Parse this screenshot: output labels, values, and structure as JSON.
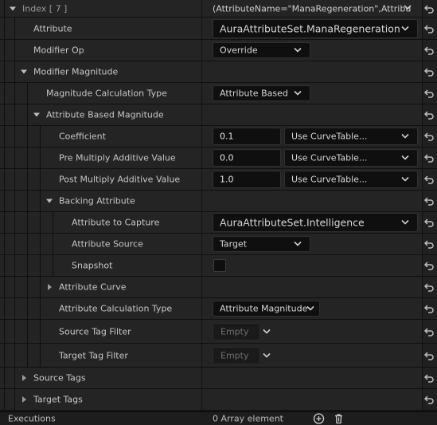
{
  "header": {
    "index_label": "Index [ 7 ]",
    "summary": "(AttributeName=\"ManaRegeneration\",Attribu"
  },
  "rows": {
    "attribute": {
      "label": "Attribute",
      "value": "AuraAttributeSet.ManaRegeneration"
    },
    "modifier_op": {
      "label": "Modifier Op",
      "value": "Override"
    },
    "modifier_magnitude": {
      "label": "Modifier Magnitude"
    },
    "magnitude_calc_type": {
      "label": "Magnitude Calculation Type",
      "value": "Attribute Based"
    },
    "attribute_based_magnitude": {
      "label": "Attribute Based Magnitude"
    },
    "coefficient": {
      "label": "Coefficient",
      "value": "0.1",
      "curve": "Use CurveTable..."
    },
    "pre_multiply": {
      "label": "Pre Multiply Additive Value",
      "value": "0.0",
      "curve": "Use CurveTable..."
    },
    "post_multiply": {
      "label": "Post Multiply Additive Value",
      "value": "1.0",
      "curve": "Use CurveTable..."
    },
    "backing_attribute": {
      "label": "Backing Attribute"
    },
    "attribute_to_capture": {
      "label": "Attribute to Capture",
      "value": "AuraAttributeSet.Intelligence"
    },
    "attribute_source": {
      "label": "Attribute Source",
      "value": "Target"
    },
    "snapshot": {
      "label": "Snapshot",
      "checked": false
    },
    "attribute_curve": {
      "label": "Attribute Curve"
    },
    "attribute_calc_type": {
      "label": "Attribute Calculation Type",
      "value": "Attribute Magnitude"
    },
    "source_tag_filter": {
      "label": "Source Tag Filter",
      "value": "Empty"
    },
    "target_tag_filter": {
      "label": "Target Tag Filter",
      "value": "Empty"
    },
    "source_tags": {
      "label": "Source Tags"
    },
    "target_tags": {
      "label": "Target Tags"
    }
  },
  "footer": {
    "executions_label": "Executions",
    "executions_value": "0 Array element"
  },
  "icons": {
    "reset": "reset-arrow-icon",
    "add": "add-element-icon",
    "delete": "trash-icon",
    "chevron": "chevron-down-icon"
  },
  "colors": {
    "background": "#151515",
    "row": "#242424",
    "field": "#0f0f0f",
    "text": "#c6c6c6"
  }
}
